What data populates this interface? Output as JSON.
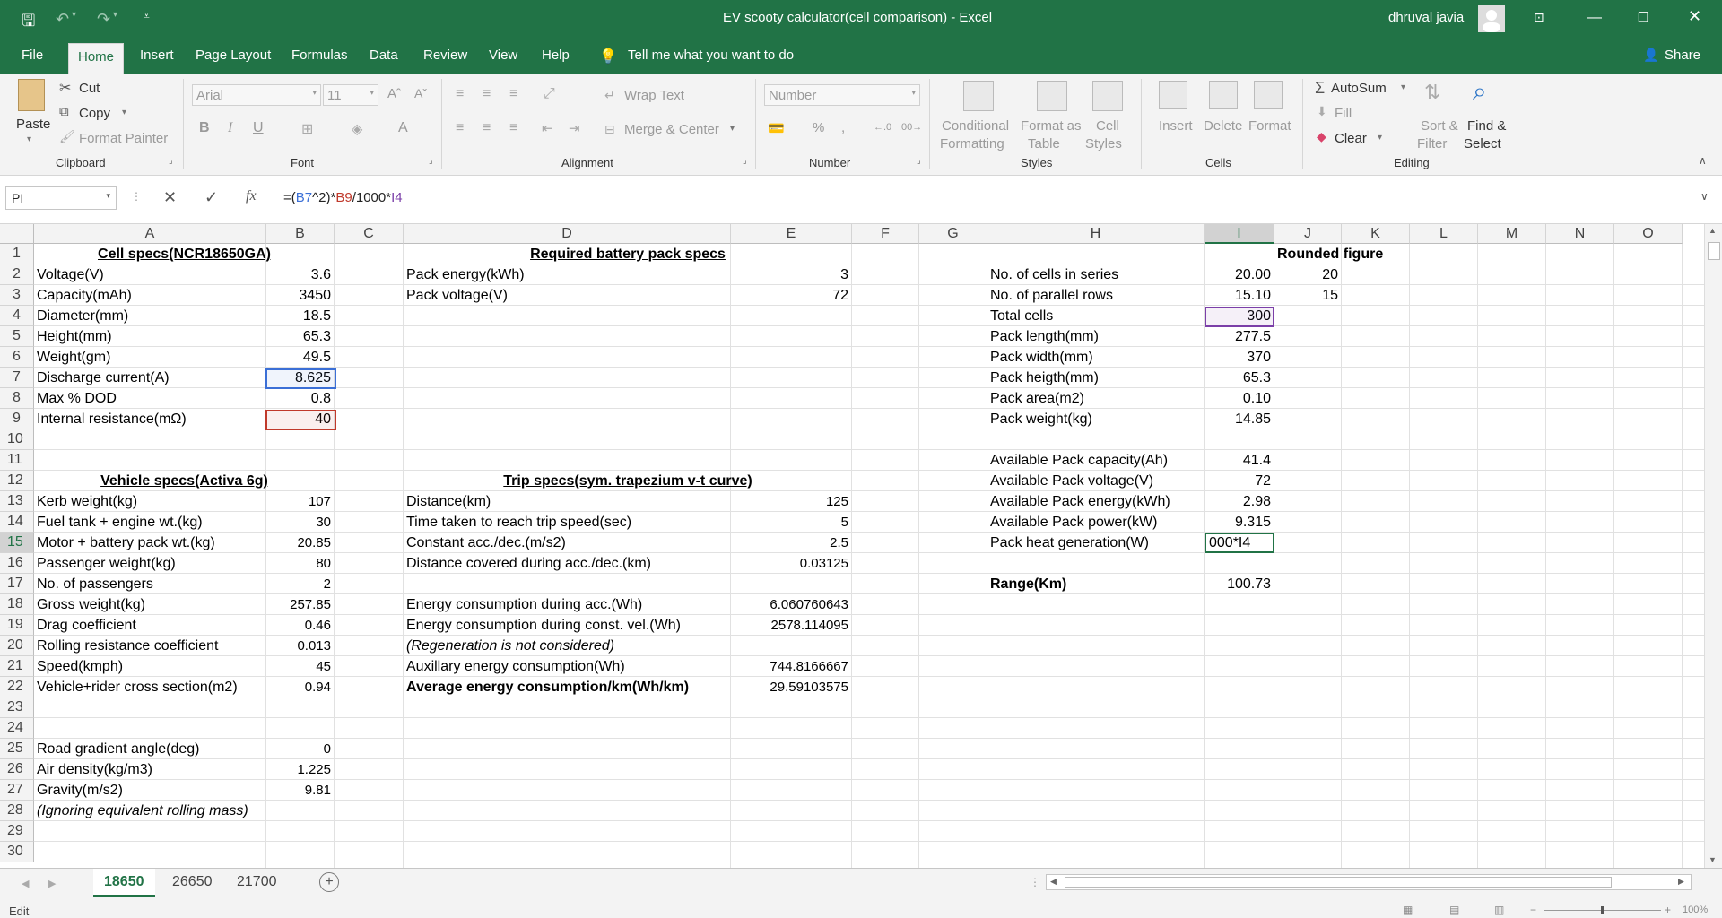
{
  "window": {
    "title": "EV scooty calculator(cell comparison)  -  Excel",
    "user": "dhruval javia",
    "qat": {
      "save_icon": "save-icon",
      "undo_icon": "undo-icon",
      "redo_icon": "redo-icon"
    }
  },
  "ribbon_tabs": [
    "File",
    "Home",
    "Insert",
    "Page Layout",
    "Formulas",
    "Data",
    "Review",
    "View",
    "Help"
  ],
  "active_tab": "Home",
  "tell_me": "Tell me what you want to do",
  "share": "Share",
  "ribbon": {
    "clipboard": {
      "paste": "Paste",
      "cut": "Cut",
      "copy": "Copy",
      "format_painter": "Format Painter",
      "label": "Clipboard"
    },
    "font": {
      "font_name": "Arial",
      "font_size": "11",
      "label": "Font"
    },
    "alignment": {
      "wrap_text": "Wrap Text",
      "merge_center": "Merge & Center",
      "label": "Alignment"
    },
    "number": {
      "format": "Number",
      "label": "Number"
    },
    "styles": {
      "conditional": "Conditional",
      "conditional2": "Formatting",
      "format_as": "Format as",
      "format_as2": "Table",
      "cell": "Cell",
      "cell2": "Styles",
      "label": "Styles"
    },
    "cells": {
      "insert": "Insert",
      "delete": "Delete",
      "format": "Format",
      "label": "Cells"
    },
    "editing": {
      "autosum": "AutoSum",
      "fill": "Fill",
      "clear": "Clear",
      "sort": "Sort &",
      "sort2": "Filter",
      "find": "Find &",
      "find2": "Select",
      "label": "Editing"
    }
  },
  "name_box": "PI",
  "formula_bar": {
    "prefix": "=(",
    "ref1": "B7",
    "mid1": "^2)*",
    "ref2": "B9",
    "mid2": "/1000*",
    "ref3": "I4"
  },
  "columns": [
    "A",
    "B",
    "C",
    "D",
    "E",
    "F",
    "G",
    "H",
    "I",
    "J",
    "K",
    "L",
    "M",
    "N",
    "O"
  ],
  "rows": [
    "1",
    "2",
    "3",
    "4",
    "5",
    "6",
    "7",
    "8",
    "9",
    "10",
    "11",
    "12",
    "13",
    "14",
    "15",
    "16",
    "17",
    "18",
    "19",
    "20",
    "21",
    "22",
    "23",
    "24",
    "25",
    "26",
    "27",
    "28",
    "29",
    "30"
  ],
  "cells": {
    "A1": "Cell specs(NCR18650GA)",
    "A2": "Voltage(V)",
    "B2": "3.6",
    "A3": "Capacity(mAh)",
    "B3": "3450",
    "A4": "Diameter(mm)",
    "B4": "18.5",
    "A5": "Height(mm)",
    "B5": "65.3",
    "A6": "Weight(gm)",
    "B6": "49.5",
    "A7": "Discharge current(A)",
    "B7": "8.625",
    "A8": "Max % DOD",
    "B8": "0.8",
    "A9": "Internal resistance(mΩ)",
    "B9": "40",
    "A12": "Vehicle specs(Activa 6g)",
    "A13": "Kerb weight(kg)",
    "B13": "107",
    "A14": "Fuel tank + engine wt.(kg)",
    "B14": "30",
    "A15": "Motor + battery pack wt.(kg)",
    "B15": "20.85",
    "A16": "Passenger weight(kg)",
    "B16": "80",
    "A17": "No. of passengers",
    "B17": "2",
    "A18": "Gross weight(kg)",
    "B18": "257.85",
    "A19": "Drag coefficient",
    "B19": "0.46",
    "A20": "Rolling resistance coefficient",
    "B20": "0.013",
    "A21": "Speed(kmph)",
    "B21": "45",
    "A22": "Vehicle+rider cross section(m2)",
    "B22": "0.94",
    "A25": "Road gradient angle(deg)",
    "B25": "0",
    "A26": "Air density(kg/m3)",
    "B26": "1.225",
    "A27": "Gravity(m/s2)",
    "B27": "9.81",
    "A28": "(Ignoring equivalent rolling mass)",
    "D1": "Required battery pack specs",
    "D2": "Pack energy(kWh)",
    "E2": "3",
    "D3": "Pack voltage(V)",
    "E3": "72",
    "D12": "Trip specs(sym. trapezium v-t curve)",
    "D13": "Distance(km)",
    "E13": "125",
    "D14": "Time taken to reach trip speed(sec)",
    "E14": "5",
    "D15": "Constant acc./dec.(m/s2)",
    "E15": "2.5",
    "D16": "Distance covered during acc./dec.(km)",
    "E16": "0.03125",
    "D18": "Energy consumption during acc.(Wh)",
    "E18": "6.060760643",
    "D19": "Energy consumption during const. vel.(Wh)",
    "E19": "2578.114095",
    "D20": "(Regeneration is not considered)",
    "D21": "Auxillary energy consumption(Wh)",
    "E21": "744.8166667",
    "D22": "Average energy consumption/km(Wh/km)",
    "E22": "29.59103575",
    "H2": "No. of cells in series",
    "I2": "20.00",
    "H3": "No. of parallel rows",
    "I3": "15.10",
    "H4": "Total cells",
    "I4": "300",
    "H5": "Pack length(mm)",
    "I5": "277.5",
    "H6": "Pack width(mm)",
    "I6": "370",
    "H7": "Pack heigth(mm)",
    "I7": "65.3",
    "H8": "Pack area(m2)",
    "I8": "0.10",
    "H9": "Pack weight(kg)",
    "I9": "14.85",
    "H11": "Available Pack capacity(Ah)",
    "I11": "41.4",
    "H12": "Available Pack voltage(V)",
    "I12": "72",
    "H13": "Available Pack energy(kWh)",
    "I13": "2.98",
    "H14": "Available Pack power(kW)",
    "I14": "9.315",
    "H15": "Pack heat generation(W)",
    "I15": "000*I4",
    "H17": "Range(Km)",
    "I17": "100.73",
    "J1": "Rounded figure",
    "J2": "20",
    "J3": "15"
  },
  "sheets": [
    "18650",
    "26650",
    "21700"
  ],
  "active_sheet": "18650",
  "status": {
    "mode": "Edit",
    "zoom": "100%"
  },
  "colors": {
    "excel_green": "#217346",
    "ref_blue": "#3b6fd6",
    "ref_red": "#c0392b",
    "ref_purple": "#7b3fa8"
  }
}
